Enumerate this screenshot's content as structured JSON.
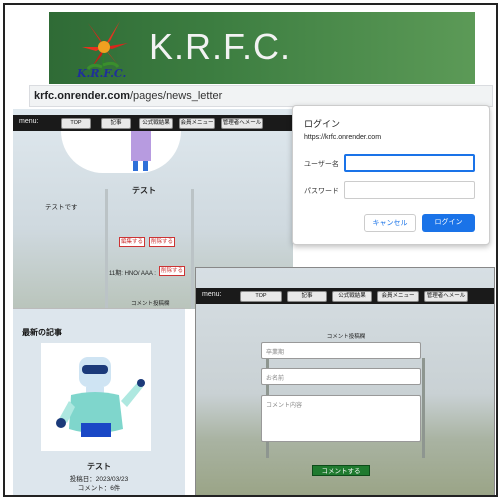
{
  "banner": {
    "logo_text": "K.R.F.C.",
    "title": "K.R.F.C."
  },
  "browser": {
    "url_domain": "krfc.onrender.com",
    "url_path": "/pages/news_letter",
    "partial_tab_text": "lub"
  },
  "site_nav": {
    "menu_label": "menu:",
    "items": [
      "TOP",
      "記事",
      "公式戦結果",
      "会員メニュー",
      "管理者へメール"
    ]
  },
  "article": {
    "title": "テスト",
    "body": "テストです",
    "edit_button": "編集する",
    "delete_button": "削除する",
    "comment_line": "11期: HNO/ AAA :",
    "comment_delete_button": "削除する",
    "comment_section_label": "コメント投稿欄"
  },
  "login_dialog": {
    "title": "ログイン",
    "site": "https://krfc.onrender.com",
    "username_label": "ユーザー名",
    "password_label": "パスワード",
    "username_value": "",
    "password_value": "",
    "cancel_button": "キャンセル",
    "login_button": "ログイン",
    "primary_color": "#1a73e8"
  },
  "latest": {
    "heading": "最新の記事",
    "title": "テスト",
    "date_line": "投稿日：2023/03/23",
    "comments_line": "コメント：6件"
  },
  "comment_form": {
    "heading": "コメント投稿欄",
    "grad_year_placeholder": "卒業期",
    "name_placeholder": "お名前",
    "content_placeholder": "コメント内容",
    "submit_button": "コメントする"
  }
}
